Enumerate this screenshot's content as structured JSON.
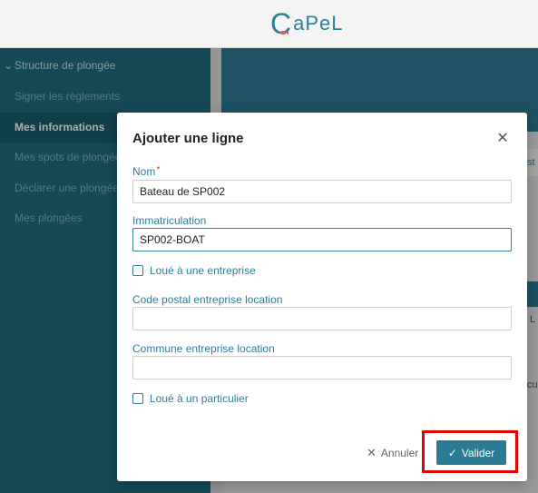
{
  "header": {
    "logo_text": "aPeL",
    "logo_initial": "C"
  },
  "sidebar": {
    "section": "Structure de plongée",
    "items": [
      {
        "label": "Signer les règlements",
        "active": false
      },
      {
        "label": "Mes informations",
        "active": true
      },
      {
        "label": "Mes spots de plongée",
        "active": false
      },
      {
        "label": "Déclarer une plongée",
        "active": false
      },
      {
        "label": "Mes plongées",
        "active": false
      }
    ]
  },
  "background": {
    "tab_text": "st",
    "text_1": "L",
    "text_2": "cu"
  },
  "modal": {
    "title": "Ajouter une ligne",
    "close_icon": "close-icon",
    "fields": {
      "nom": {
        "label": "Nom",
        "required_mark": "*",
        "value": "Bateau de SP002"
      },
      "immatriculation": {
        "label": "Immatriculation",
        "value": "SP002-BOAT"
      },
      "loue_entreprise": {
        "label": "Loué à une entreprise",
        "checked": false
      },
      "code_postal": {
        "label": "Code postal entreprise location",
        "value": ""
      },
      "commune": {
        "label": "Commune entreprise location",
        "value": ""
      },
      "loue_particulier": {
        "label": "Loué à un particulier",
        "checked": false
      }
    },
    "buttons": {
      "cancel": "Annuler",
      "validate": "Valider"
    }
  },
  "colors": {
    "accent": "#2e7f98",
    "sidebar": "#1f6c82",
    "highlight": "#e00000",
    "required": "#d62828"
  }
}
